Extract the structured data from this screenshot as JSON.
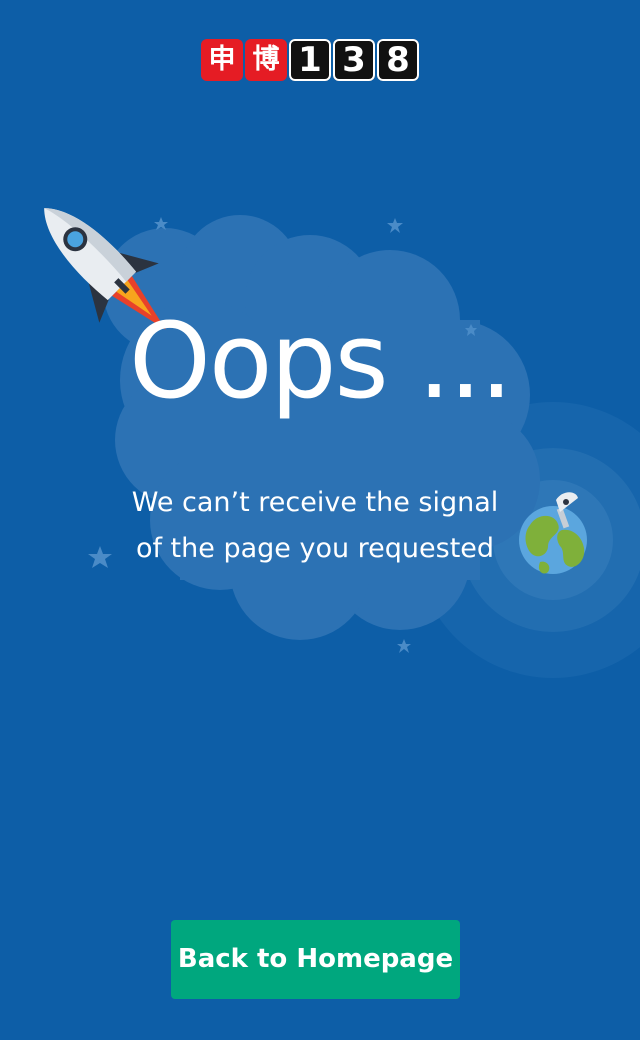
{
  "logo": {
    "chars": [
      "申",
      "博"
    ],
    "digits": [
      "1",
      "3",
      "8"
    ]
  },
  "headline": "Oops ...",
  "message": {
    "line1": "We can’t receive the signal",
    "line2": "of the page you requested"
  },
  "home_button": {
    "label": "Back to Homepage"
  },
  "icons": [
    "rocket-icon",
    "globe-icon",
    "satellite-dish-icon",
    "star-icon"
  ],
  "colors": {
    "background": "#0d5ea7",
    "cloud": "#2c72b4",
    "button": "#00a77e",
    "logo_red": "#e51c24",
    "logo_black": "#111111",
    "text": "#ffffff"
  }
}
